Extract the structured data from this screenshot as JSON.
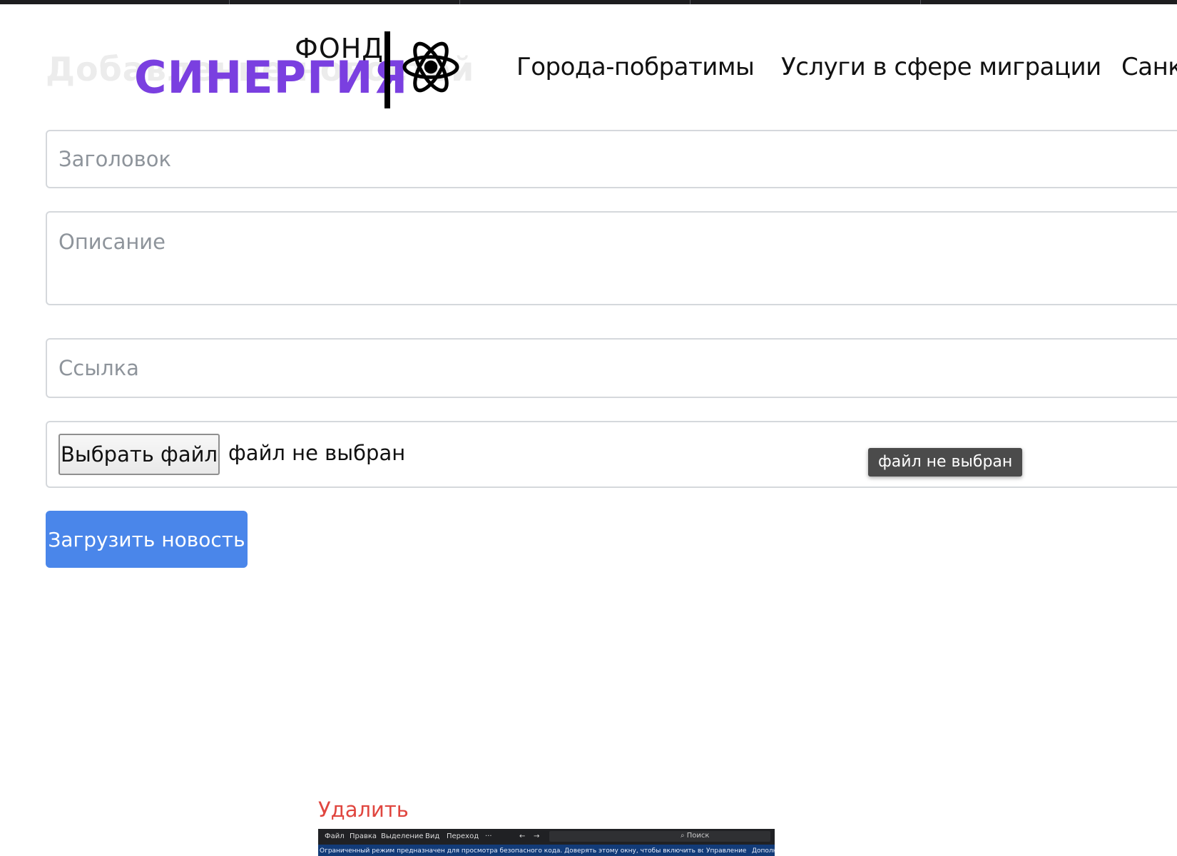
{
  "header": {
    "logo": {
      "top_text": "ФОНД",
      "name": "СИНЕРГИЯ",
      "icon": "atom-icon",
      "brand_color": "#7a3fe0"
    },
    "nav": [
      {
        "label": "Города-побратимы"
      },
      {
        "label": "Услуги в сфере миграции"
      },
      {
        "label": "Санк"
      }
    ]
  },
  "form": {
    "heading": "Добавление новостей",
    "title_placeholder": "Заголовок",
    "description_placeholder": "Описание",
    "link_placeholder": "Ссылка",
    "file_button_label": "Выбрать файл",
    "file_status": "файл не выбран",
    "file_tooltip": "файл не выбран",
    "submit_label": "Загрузить новость",
    "submit_color": "#4a86ea"
  },
  "news_card": {
    "delete_label": "Удалить",
    "delete_color": "#e0463f",
    "thumbnail": {
      "menu": [
        "Файл",
        "Правка",
        "Выделение",
        "Вид",
        "Переход",
        "···"
      ],
      "nav_arrows": [
        "←",
        "→"
      ],
      "search_label": "Поиск",
      "banner_text": "Ограниченный режим предназначен для просмотра безопасного кода. Доверять этому окну, чтобы включить все функции.",
      "banner_links": [
        "Управление",
        "Дополн"
      ]
    }
  }
}
